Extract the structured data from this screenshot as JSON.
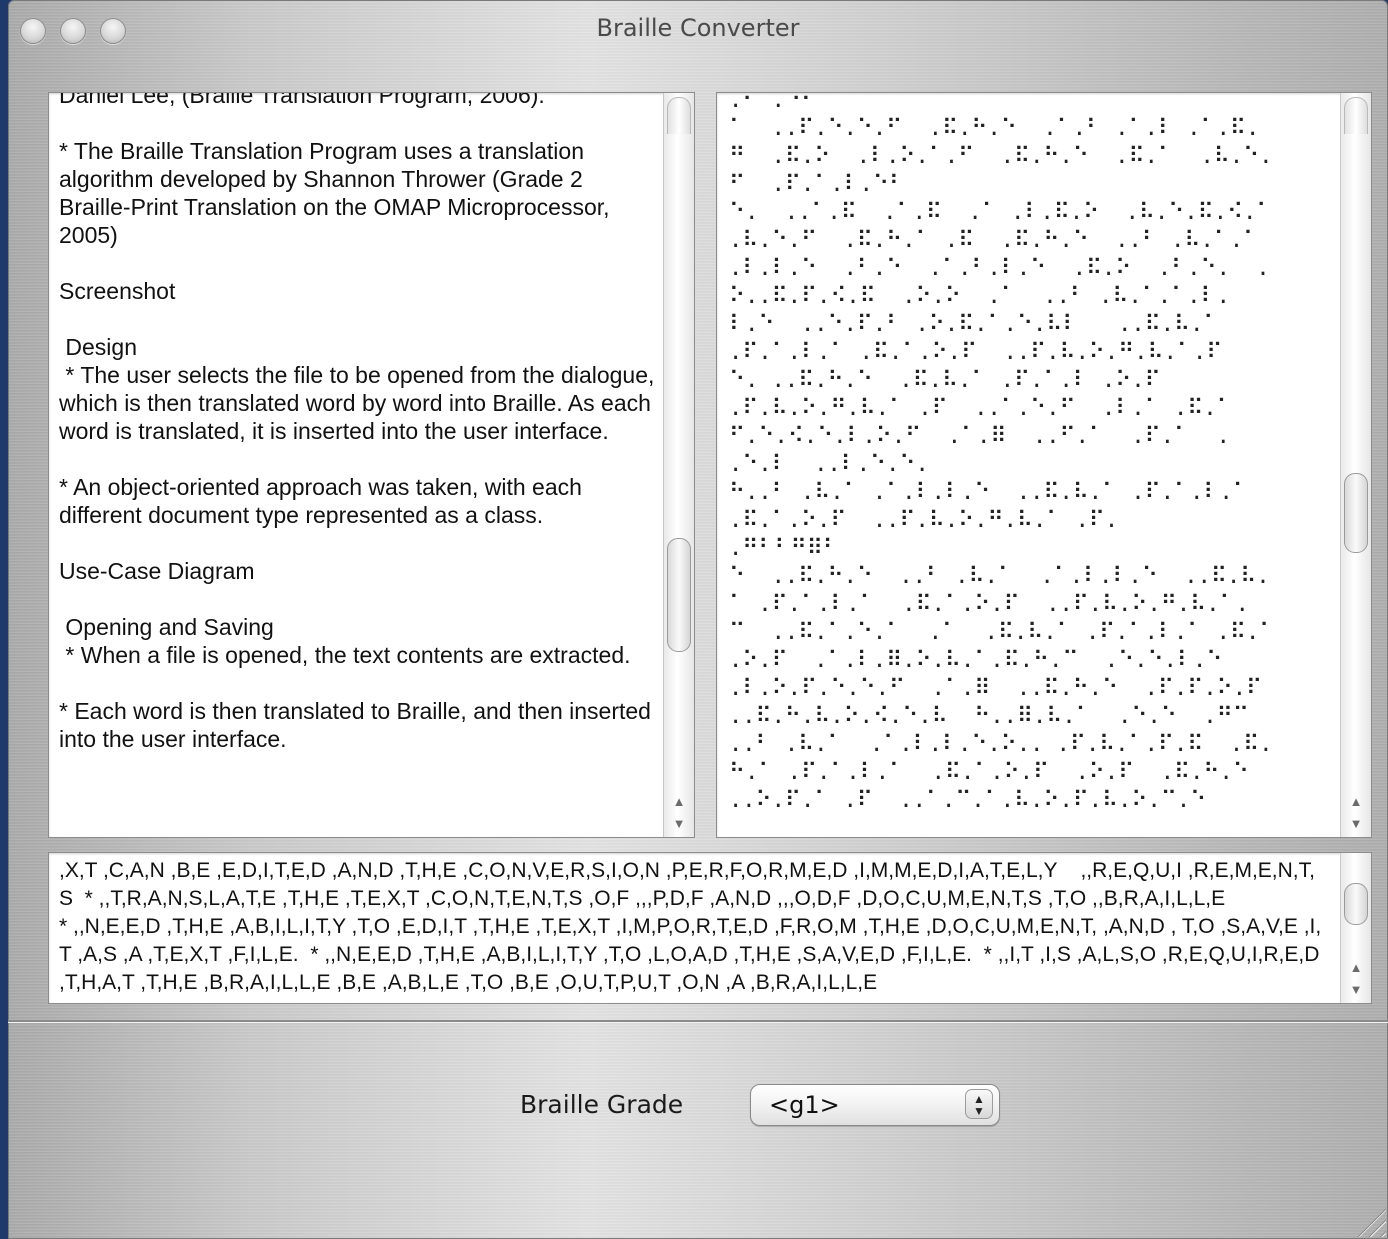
{
  "window": {
    "title": "Braille Converter"
  },
  "left_pane": {
    "text": "Daniel Lee, (Braille Translation Program, 2006).\n\n* The Braille Translation Program uses a translation algorithm developed by Shannon Thrower (Grade 2 Braille-Print Translation on the OMAP Microprocessor, 2005)\n\nScreenshot\n\n Design\n * The user selects the file to be opened from the dialogue, which is then translated word by word into Braille. As each word is translated, it is inserted into the user interface.\n\n* An object-oriented approach was taken, with each different document type represented as a class.\n\nUse-Case Diagram\n\n Opening and Saving\n * When a file is opened, the text contents are extracted.\n\n* Each word is then translated to Braille, and then inserted into the user interface.",
    "scroll_position": 0.7
  },
  "right_pane": {
    "braille_text": ".⠃ .⠑⠃\n⠁  ..⠏.⠑.⠑.⠋  .⠯.⠓.⠑  .⠁.⠃ .⠁.⠇ .⠁.⠯.\n⠛  .⠯.⠕  .⠇.⠕.⠁.⠋  .⠯.⠓.⠑  .⠯.⠁  .⠧.⠑.\n⠋  .⠏.⠁.⠇.⠑⠃\n⠑.  ..⠁.⠯  .⠁.⠯  .⠁ .⠇.⠯.⠕  .⠧.⠑.⠯.⠪.⠁\n.⠧.⠑.⠋  .⠯.⠓.⠁ .⠯  .⠯.⠓.⠑  ..⠃ .⠧.⠁.⠁\n.⠇.⠇.⠑  .⠃.⠑  .⠁.⠃.⠇.⠑  .⠯.⠕  .⠃.⠑.  .\n⠕..⠯.⠏.⠪.⠯  .⠕.⠕  .⠁  ..⠃ .⠧.⠁.⠁.⠇.\n⠇.⠑  ..⠑.⠏.⠃ .⠕.⠯.⠁.⠑.⠧⠇   ..⠯.⠧.⠁\n.⠏.⠁.⠇.⠁ .⠯.⠁.⠕.⠏  ..⠏.⠧.⠕.⠛.⠧.⠁.⠏\n⠑. ..⠯.⠓.⠑  .⠯.⠧.⠁ .⠏.⠁.⠇ .⠕.⠏\n.⠏.⠧.⠕.⠛.⠧.⠁ .⠏  ..⠁.⠑.⠋  .⠇.⠁ .⠯.⠁\n⠋.⠑.⠪.⠑.⠇.⠕.⠋  .⠁.⠿  ..⠋.⠁  .⠏.⠁  .\n.⠑.⠇  ..⠇.⠑.⠑.\n⠓..⠃ .⠧.⠁ .⠁.⠇.⠇.⠑  ..⠯.⠧.⠁ .⠏.⠁.⠇.⠁\n.⠯.⠁.⠕.⠏  ..⠏.⠧.⠕.⠛.⠧.⠁ .⠏.\n.⠛⠃⠃⠛⠿⠃\n⠑  ..⠯.⠓.⠑  ..⠃ .⠧.⠁  .⠁.⠇.⠇.⠑  ..⠯.⠧.\n⠁ .⠏.⠁.⠇.⠁  .⠯.⠁.⠕.⠏  ..⠏.⠧.⠕.⠛.⠧.⠁.\n⠉  ..⠯.⠁.⠑.⠁  .⠁  .⠯.⠧.⠁ .⠏.⠁.⠇.⠁ .⠯.⠁\n.⠕.⠏  .⠁.⠇.⠿.⠕.⠧.⠁.⠯.⠓.⠉  .⠑.⠑.⠇.⠑\n.⠇.⠕.⠏.⠑.⠑.⠋  .⠁.⠿  ..⠯.⠓.⠑  .⠏.⠏.⠕.⠏\n..⠯.⠓.⠧.⠕.⠪.⠑.⠧  ⠓..⠿.⠧.⠁  .⠑.⠑  .⠛⠉\n..⠃ .⠧.⠁  .⠁.⠇.⠇.⠑.⠕.. .⠏.⠧.⠁.⠏.⠯  .⠯.\n⠓.⠁ .⠏.⠁.⠇.⠁  .⠯.⠁.⠕.⠏  .⠕.⠏  .⠯.⠓.⠑\n..⠕.⠏.⠁ .⠏  ..⠁.⠉.⠁.⠧.⠕.⠏.⠧.⠕.⠉.⠑",
    "scroll_position": 0.55
  },
  "bottom_pane": {
    "text": ",X,T ,C,A,N ,B,E ,E,D,I,T,E,D ,A,N,D ,T,H,E ,C,O,N,V,E,R,S,I,O,N ,P,E,R,F,O,R,M,E,D ,I,M,M,E,D,I,A,T,E,L,Y    ,,R,E,Q,U,I ,R,E,M,E,N,T,S  * ,,T,R,A,N,S,L,A,T,E ,T,H,E ,T,E,X,T ,C,O,N,T,E,N,T,S ,O,F ,,,P,D,F ,A,N,D ,,,O,D,F ,D,O,C,U,M,E,N,T,S ,T,O ,,B,R,A,I,L,L,E\n* ,,N,E,E,D ,T,H,E ,A,B,I,L,I,T,Y ,T,O ,E,D,I,T ,T,H,E ,T,E,X,T ,I,M,P,O,R,T,E,D ,F,R,O,M ,T,H,E ,D,O,C,U,M,E,N,T, ,A,N,D , T,O ,S,A,V,E ,I,T ,A,S ,A ,T,E,X,T ,F,I,L,E.  * ,,N,E,E,D ,T,H,E ,A,B,I,L,I,T,Y ,T,O ,L,O,A,D ,T,H,E ,S,A,V,E,D ,F,I,L,E.  * ,,I,T ,I,S ,A,L,S,O ,R,E,Q,U,I,R,E,D ,T,H,A,T ,T,H,E ,B,R,A,I,L,L,E ,B,E ,A,B,L,E ,T,O ,B,E ,O,U,T,P,U,T ,O,N ,A ,B,R,A,I,L,L,E"
  },
  "controls": {
    "grade_label": "Braille Grade",
    "grade_value": "<g1>"
  }
}
